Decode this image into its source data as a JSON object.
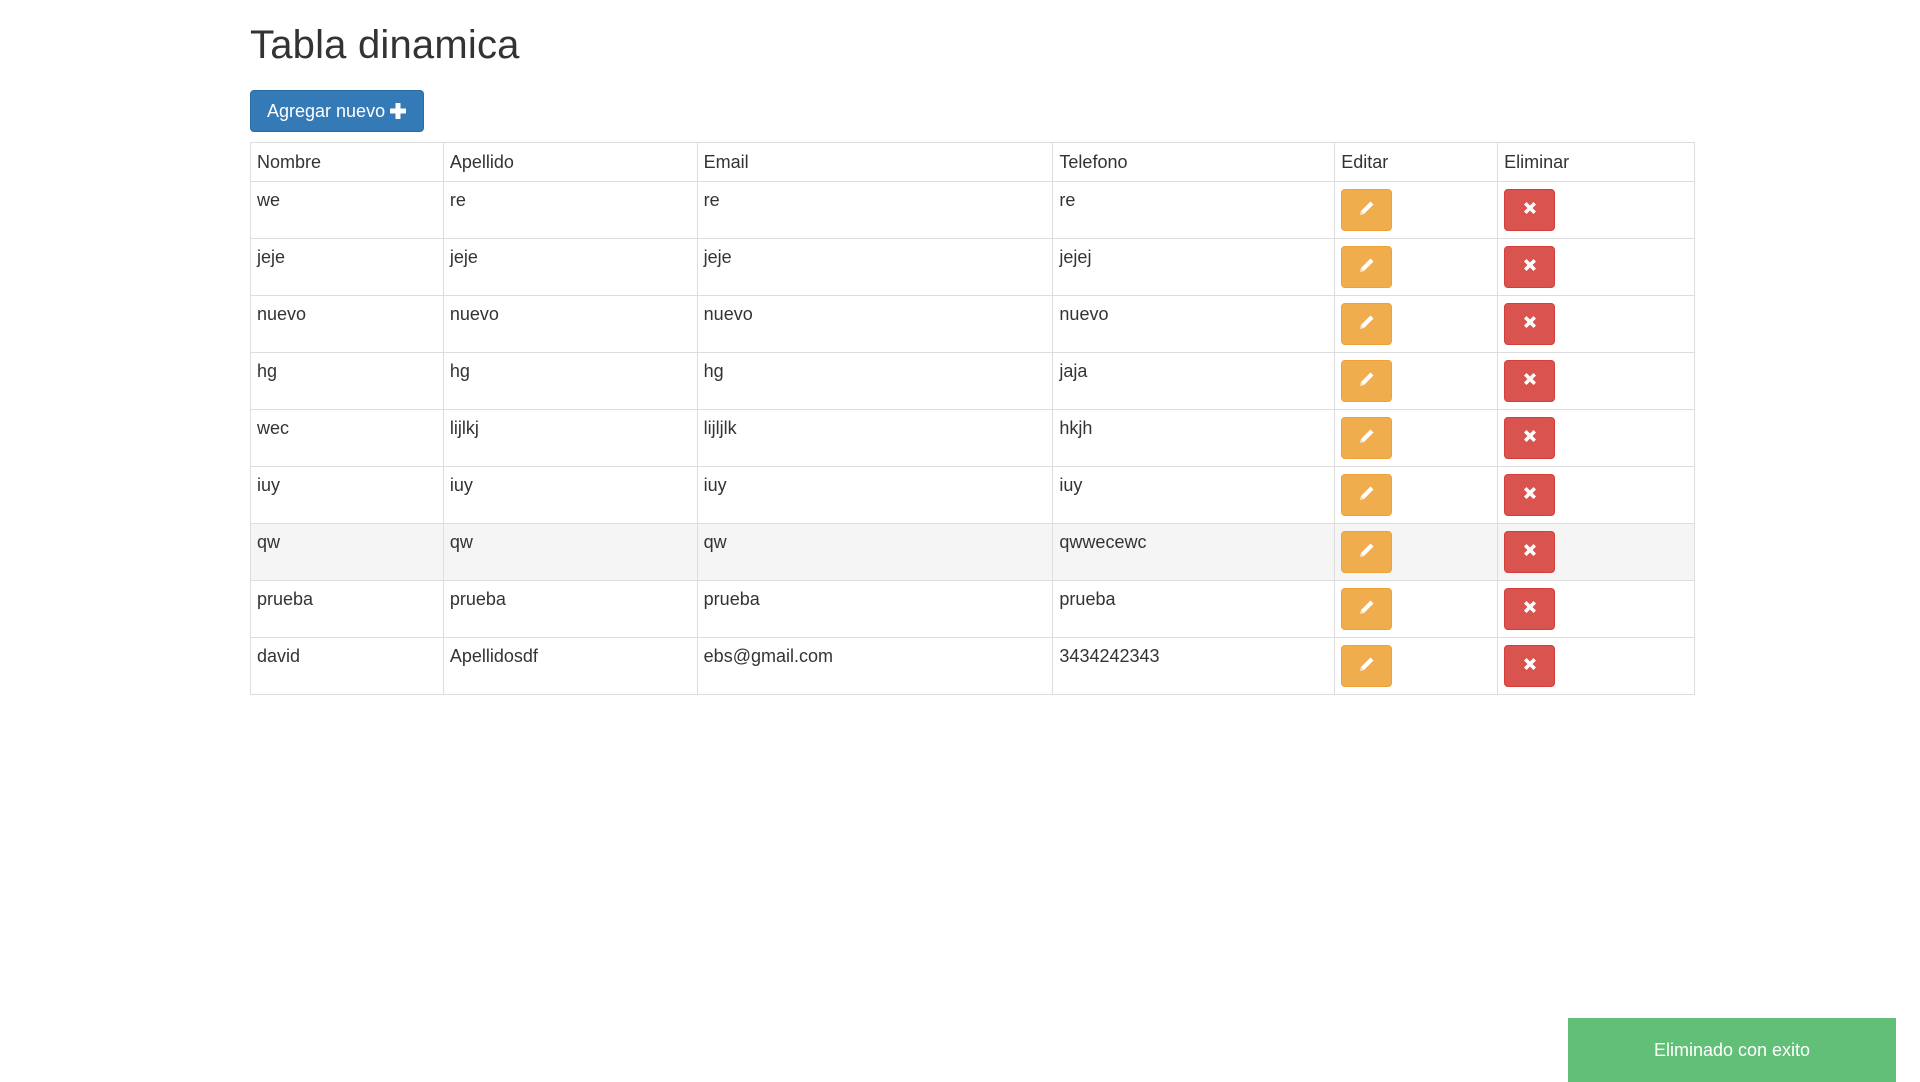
{
  "page": {
    "title": "Tabla dinamica"
  },
  "toolbar": {
    "add_label": "Agregar nuevo",
    "add_icon": "plus-icon"
  },
  "table": {
    "headers": {
      "nombre": "Nombre",
      "apellido": "Apellido",
      "email": "Email",
      "telefono": "Telefono",
      "editar": "Editar",
      "eliminar": "Eliminar"
    },
    "edit_icon": "pencil-icon",
    "delete_icon": "close-icon",
    "rows": [
      {
        "nombre": "we",
        "apellido": "re",
        "email": "re",
        "telefono": "re"
      },
      {
        "nombre": "jeje",
        "apellido": "jeje",
        "email": "jeje",
        "telefono": "jejej"
      },
      {
        "nombre": "nuevo",
        "apellido": "nuevo",
        "email": "nuevo",
        "telefono": "nuevo"
      },
      {
        "nombre": "hg",
        "apellido": "hg",
        "email": "hg",
        "telefono": "jaja"
      },
      {
        "nombre": "wec",
        "apellido": "lijlkj",
        "email": "lijljlk",
        "telefono": "hkjh"
      },
      {
        "nombre": "iuy",
        "apellido": "iuy",
        "email": "iuy",
        "telefono": "iuy"
      },
      {
        "nombre": "qw",
        "apellido": "qw",
        "email": "qw",
        "telefono": "qwwecewc"
      },
      {
        "nombre": "prueba",
        "apellido": "prueba",
        "email": "prueba",
        "telefono": "prueba"
      },
      {
        "nombre": "david",
        "apellido": "Apellidosdf",
        "email": "ebs@gmail.com",
        "telefono": "3434242343"
      }
    ],
    "highlighted_row": 6
  },
  "toast": {
    "message": "Eliminado con exito"
  },
  "colors": {
    "primary": "#337ab7",
    "warning": "#f0ad4e",
    "danger": "#d9534f",
    "success_toast": "#62bf78",
    "row_hover": "#f5f5f5"
  }
}
